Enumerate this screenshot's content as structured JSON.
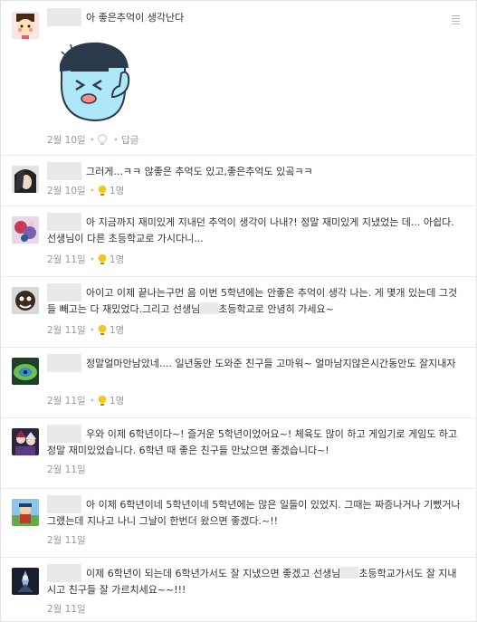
{
  "comments": [
    {
      "text_before": "아 좋은추억이 생각난다",
      "text_after": "",
      "date": "2월 10일",
      "likes": "",
      "reply": "답글",
      "liked": false
    },
    {
      "text_before": "그러게...ㅋㅋ 않좋은 추억도 있고,좋은추억도 있곸ㅋㅋ",
      "text_after": "",
      "date": "2월 10일",
      "likes": "1명",
      "reply": "",
      "liked": true
    },
    {
      "text_before": "아 지금까지 재미있게 지내던 추억이 생각이 나내?! 정말 재미있게 지냈었는 데... 아쉽다. 선생님이 다른 초등학교로 가시다니...",
      "text_after": "",
      "date": "2월 11일",
      "likes": "1명",
      "reply": "",
      "liked": true
    },
    {
      "text_before": "아이고 이제 끝나는구먼 음 이번 5학년에는 안좋은 추억이 생각 나는. 게 몇개 있는데 그것들 빼고는 다 재밌었다.그리고 선생님",
      "text_after": "초등학교로 안녕히 가세요~",
      "date": "2월 11일",
      "likes": "1명",
      "reply": "",
      "liked": true
    },
    {
      "text_before": "정말얼마안남았네.... 일년동안 도와준 친구들 고마워~ 얼마남지않은시간동안도 잘지내자",
      "text_after": "",
      "date": "2월 11일",
      "likes": "1명",
      "reply": "",
      "liked": true
    },
    {
      "text_before": "우와 이제 6학년이다~! 즐거운 5학년이었어요~! 체육도 많이 하고 게임기로 게임도 하고 정말 재미있었습니다. 6학년 때 좋은 친구들 만났으면 좋겠습니다~!",
      "text_after": "",
      "date": "2월 11일",
      "likes": "",
      "reply": "",
      "liked": false
    },
    {
      "text_before": "아 이제 6학년이네 5학년이네 5학년에는 많은 일들이 있었지. 그때는 짜증나거나 기뻤거나 그랬는데 지나고 나니 그날이 한번더 왔으면 좋겠다.~!!",
      "text_after": "",
      "date": "2월 11일",
      "likes": "",
      "reply": "",
      "liked": false
    },
    {
      "text_before": "이제 6학년이 되는데 6학년가서도 잘 지냈으면 좋겠고 선생님",
      "text_after": "초등학교가서도 잘 지내시고 친구들 잘 가르치세요~~!!!",
      "date": "2월 11일",
      "likes": "",
      "reply": "",
      "liked": false
    }
  ],
  "colors": {
    "bulb_on": "#f5c518",
    "bulb_off": "#d0d0d0",
    "name_placeholder": "#e9e9e9",
    "meta": "#999999"
  },
  "icons": {
    "like": "lightbulb-icon",
    "menu": "more-menu-icon"
  }
}
